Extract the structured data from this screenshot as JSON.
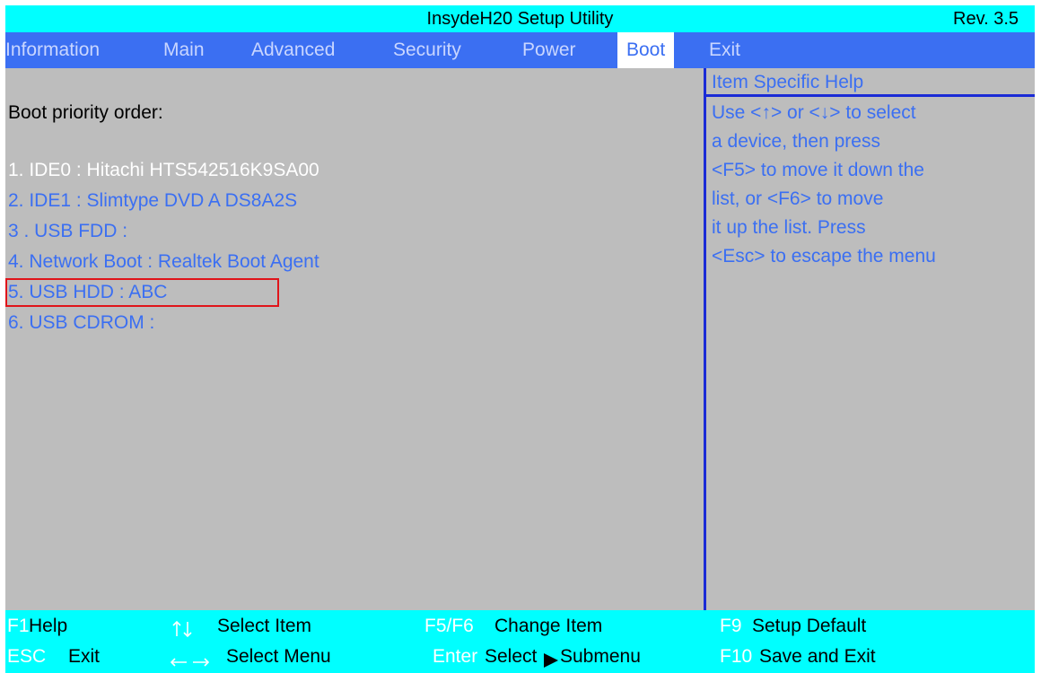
{
  "title": "InsydeH20 Setup Utility",
  "revision": "Rev. 3.5",
  "menu": [
    {
      "label": "Information"
    },
    {
      "label": "Main"
    },
    {
      "label": "Advanced"
    },
    {
      "label": "Security"
    },
    {
      "label": "Power"
    },
    {
      "label": "Boot",
      "active": true
    },
    {
      "label": "Exit"
    }
  ],
  "main": {
    "heading": "Boot priority order:",
    "boot_items": [
      {
        "label": "1. IDE0 : Hitachi HTS542516K9SA00",
        "selected": true
      },
      {
        "label": "2. IDE1 : Slimtype DVD A DS8A2S"
      },
      {
        "label": "3 . USB FDD :"
      },
      {
        "label": "4. Network Boot : Realtek Boot Agent"
      },
      {
        "label": "5. USB HDD : ABC",
        "outlined": true
      },
      {
        "label": "6. USB CDROM :"
      }
    ]
  },
  "help": {
    "title": "Item Specific Help",
    "lines": [
      "Use <↑> or <↓> to select",
      "a device, then press",
      "<F5> to move it down the",
      "list, or <F6> to move",
      "it up the list. Press",
      "<Esc> to escape the menu"
    ]
  },
  "footer": {
    "f1_key": "F1",
    "f1_desc": "Help",
    "updown_desc": "Select Item",
    "f5f6_key": "F5/F6",
    "f5f6_desc": "Change Item",
    "f9_key": "F9",
    "f9_desc": "Setup Default",
    "esc_key": "ESC",
    "esc_desc": "Exit",
    "leftright_desc": "Select Menu",
    "enter_key": "Enter",
    "enter_desc_a": "Select",
    "enter_desc_b": "Submenu",
    "f10_key": "F10",
    "f10_desc": "Save and Exit"
  },
  "colors": {
    "title_bar": "#00ffff",
    "menu_bar": "#3b6ff2",
    "body": "#bdbdbd",
    "item_text": "#3b6ff2",
    "selected_text": "#ffffff",
    "outline": "#e0141a",
    "divider": "#1a2bd6"
  }
}
